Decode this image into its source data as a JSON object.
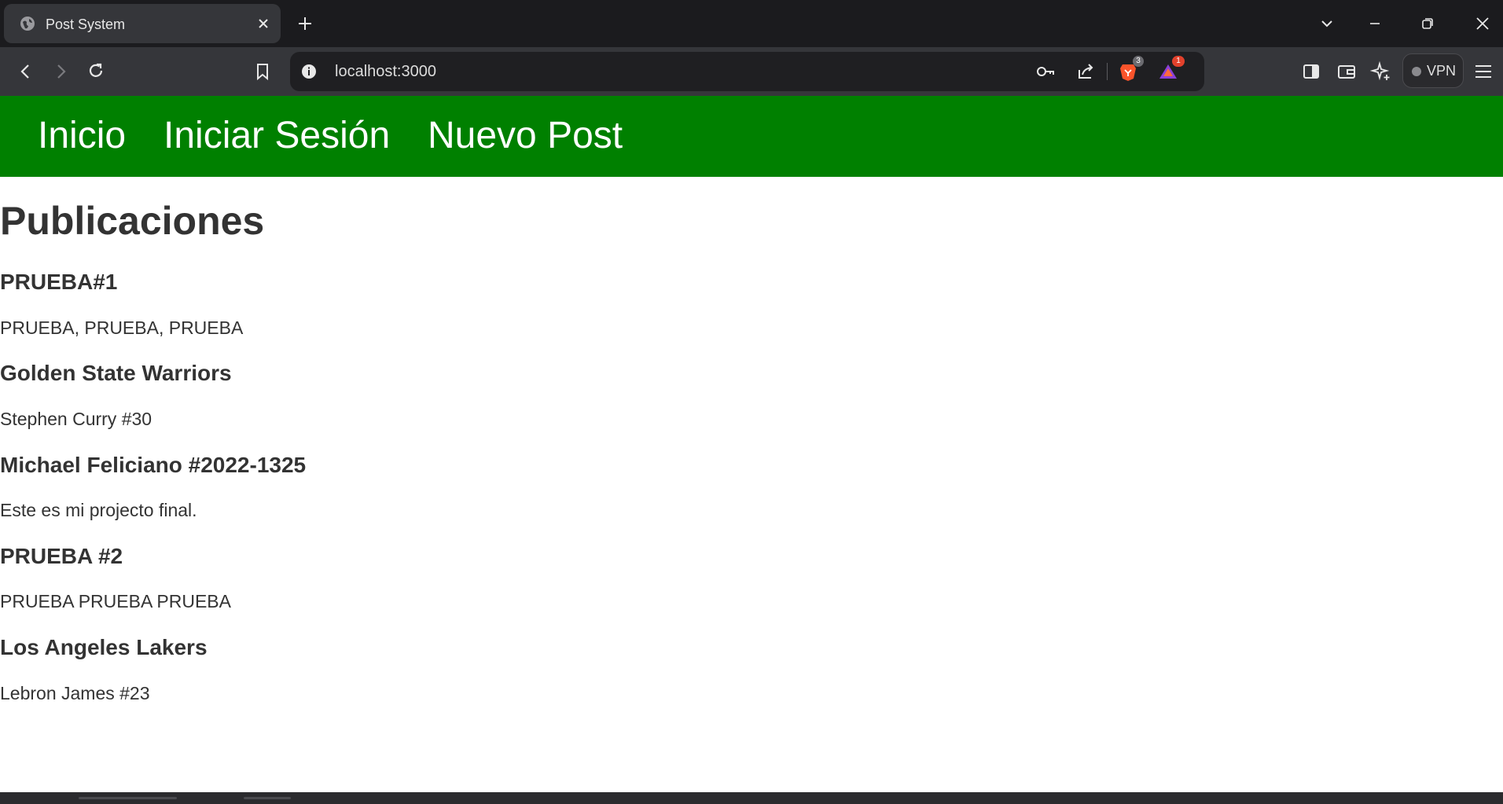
{
  "browser": {
    "tab_title": "Post System",
    "url": "localhost:3000",
    "brave_shields_count": "3",
    "rewards_count": "1",
    "vpn_label": "VPN"
  },
  "nav": {
    "links": [
      "Inicio",
      "Iniciar Sesión",
      "Nuevo Post"
    ]
  },
  "page": {
    "heading": "Publicaciones",
    "posts": [
      {
        "title": "PRUEBA#1",
        "body": "PRUEBA, PRUEBA, PRUEBA"
      },
      {
        "title": "Golden State Warriors",
        "body": "Stephen Curry #30"
      },
      {
        "title": "Michael Feliciano #2022-1325",
        "body": "Este es mi projecto final."
      },
      {
        "title": "PRUEBA #2",
        "body": "PRUEBA PRUEBA PRUEBA"
      },
      {
        "title": "Los Angeles Lakers",
        "body": "Lebron James #23"
      }
    ]
  },
  "colors": {
    "navbar": "#008000",
    "text": "#333333",
    "browser_tabbar": "#1b1b1e",
    "browser_toolbar": "#35363a"
  },
  "icons": {
    "favicon": "globe-icon",
    "tab_close": "close-icon",
    "new_tab": "plus-icon",
    "back": "back-arrow-icon",
    "forward": "forward-arrow-icon",
    "reload": "reload-icon",
    "bookmark": "bookmark-icon",
    "site_info": "info-icon",
    "password": "key-icon",
    "share": "share-icon",
    "brave": "brave-lion-icon",
    "rewards": "rewards-triangle-icon",
    "sidebar": "sidebar-icon",
    "wallet": "wallet-icon",
    "leo": "leo-sparkle-icon",
    "tab_search": "chevron-down-icon",
    "minimize": "minimize-icon",
    "restore": "restore-icon",
    "close_window": "close-window-icon",
    "menu": "hamburger-menu-icon"
  }
}
